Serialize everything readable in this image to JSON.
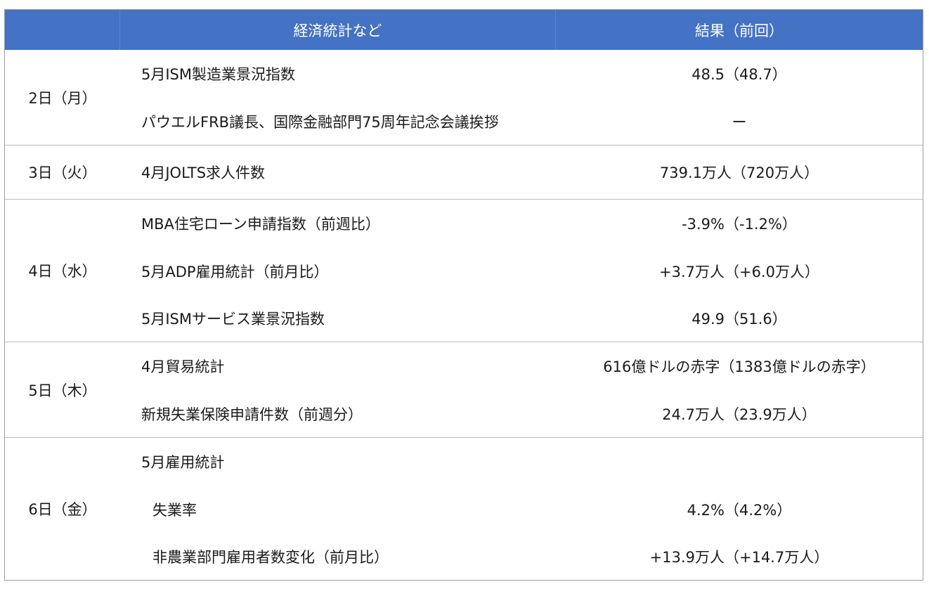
{
  "header": {
    "col_day": "",
    "col_indicator": "経済統計など",
    "col_result": "結果（前回）"
  },
  "groups": [
    {
      "day": "2日（月）",
      "rows": [
        {
          "indicator": "5月ISM製造業景況指数",
          "result": "48.5（48.7）"
        },
        {
          "indicator": "パウエルFRB議長、国際金融部門75周年記念会議挨拶",
          "result": "ー"
        }
      ]
    },
    {
      "day": "3日（火）",
      "rows": [
        {
          "indicator": "4月JOLTS求人件数",
          "result": "739.1万人（720万人）"
        }
      ]
    },
    {
      "day": "4日（水）",
      "rows": [
        {
          "indicator": "MBA住宅ローン申請指数（前週比）",
          "result": "-3.9%（-1.2%）"
        },
        {
          "indicator": "5月ADP雇用統計（前月比）",
          "result": "+3.7万人（+6.0万人）"
        },
        {
          "indicator": "5月ISMサービス業景況指数",
          "result": "49.9（51.6）"
        }
      ]
    },
    {
      "day": "5日（木）",
      "rows": [
        {
          "indicator": "4月貿易統計",
          "result": "616億ドルの赤字（1383億ドルの赤字）"
        },
        {
          "indicator": "新規失業保険申請件数（前週分）",
          "result": "24.7万人（23.9万人）"
        }
      ]
    },
    {
      "day": "6日（金）",
      "rows": [
        {
          "indicator": "5月雇用統計",
          "result": ""
        },
        {
          "indicator": "失業率",
          "result": "4.2%（4.2%）"
        },
        {
          "indicator": "非農業部門雇用者数変化（前月比）",
          "result": "+13.9万人（+14.7万人）"
        }
      ]
    }
  ]
}
